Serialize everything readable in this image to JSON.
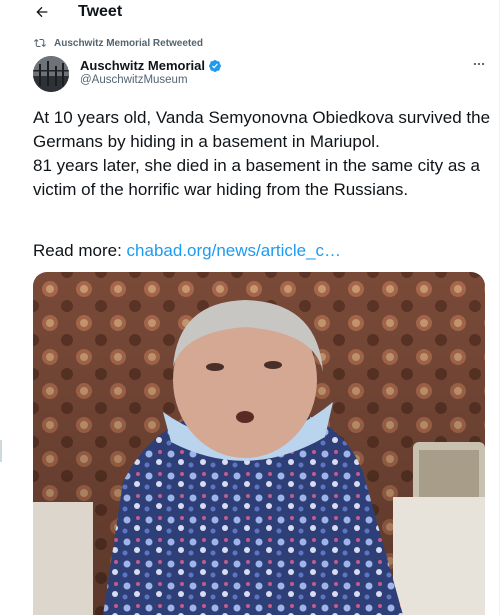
{
  "header": {
    "title": "Tweet",
    "back_icon": "arrow-left-icon"
  },
  "retweet": {
    "icon": "retweet-icon",
    "text": "Auschwitz Memorial Retweeted"
  },
  "author": {
    "name": "Auschwitz Memorial",
    "handle": "@AuschwitzMuseum",
    "verified_icon": "verified-badge-icon",
    "more_icon": "more-horizontal-icon"
  },
  "tweet": {
    "paragraph1": "At 10 years old, Vanda Semyonovna Obiedkova survived the Germans by hiding in a basement in Mariupol.",
    "paragraph2": "81 years later, she died in a basement in the same city as a victim of the horrific war hiding from the Russians.",
    "read_more_label": "Read more: ",
    "link_text": "chabad.org/news/article_c…"
  },
  "colors": {
    "link": "#1d9bf0",
    "secondary_text": "#536471",
    "verified": "#1d9bf0"
  }
}
